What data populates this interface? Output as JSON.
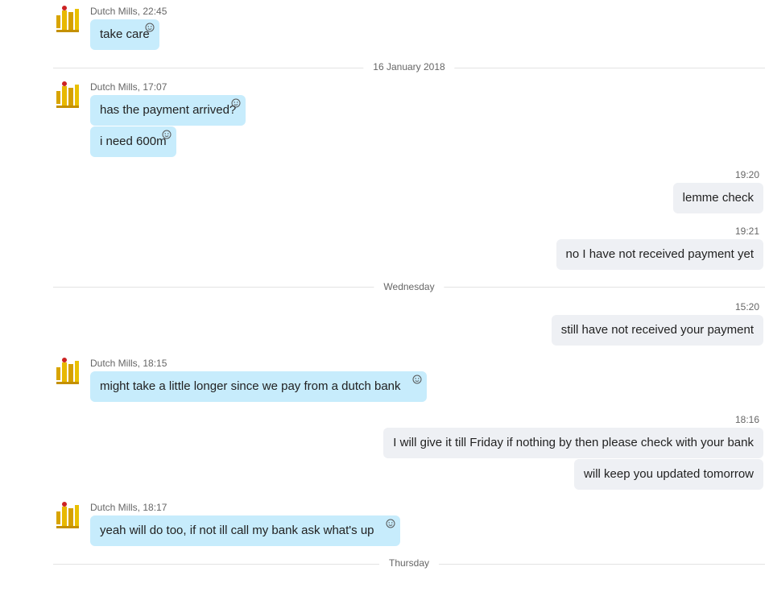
{
  "contact": {
    "name": "Dutch Mills"
  },
  "dividers": [
    "16 January 2018",
    "Wednesday",
    "Thursday"
  ],
  "groups": [
    {
      "sender": "Dutch Mills,",
      "time": "22:45",
      "messages": [
        "take care"
      ]
    },
    {
      "sender": "Dutch Mills,",
      "time": "17:07",
      "messages": [
        "has the payment arrived?",
        "i need 600m"
      ]
    },
    {
      "time": "19:20",
      "messages": [
        "lemme check"
      ]
    },
    {
      "time": "19:21",
      "messages": [
        "no I have not received payment yet"
      ]
    },
    {
      "time": "15:20",
      "messages": [
        "still have not received your payment"
      ]
    },
    {
      "sender": "Dutch Mills,",
      "time": "18:15",
      "messages": [
        "might take a little longer since we pay from a dutch bank"
      ]
    },
    {
      "time": "18:16",
      "messages": [
        "I will give it till Friday if nothing by then please check with your bank",
        "will keep you updated tomorrow"
      ]
    },
    {
      "sender": "Dutch Mills,",
      "time": "18:17",
      "messages": [
        "yeah will do too, if not ill call my bank ask what's up"
      ]
    }
  ]
}
